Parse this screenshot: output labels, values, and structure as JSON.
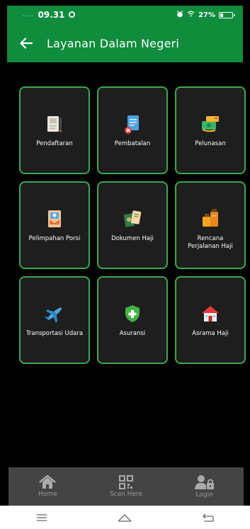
{
  "status": {
    "time": "09.31",
    "signal": "....",
    "battery": "27%",
    "battery_level": 0.27
  },
  "header": {
    "title": "Layanan Dalam Negeri"
  },
  "menu": [
    {
      "label": "Pendaftaran",
      "icon": "registration-icon"
    },
    {
      "label": "Pembatalan",
      "icon": "cancellation-icon"
    },
    {
      "label": "Pelunasan",
      "icon": "payment-icon"
    },
    {
      "label": "Pelimpahan Porsi",
      "icon": "transfer-quota-icon"
    },
    {
      "label": "Dokumen Haji",
      "icon": "hajj-document-icon"
    },
    {
      "label": "Rencana\nPerjalanan Haji",
      "icon": "travel-plan-icon"
    },
    {
      "label": "Transportasi Udara",
      "icon": "airplane-icon"
    },
    {
      "label": "Asuransi",
      "icon": "insurance-shield-icon"
    },
    {
      "label": "Asrama Haji",
      "icon": "dormitory-icon"
    }
  ],
  "bottom_nav": [
    {
      "label": "Home",
      "icon": "home-icon"
    },
    {
      "label": "Scan Here",
      "icon": "qr-scan-icon"
    },
    {
      "label": "Login",
      "icon": "user-lock-icon"
    }
  ],
  "colors": {
    "primary": "#0f8c3c",
    "tile_border": "#3aa84e",
    "tile_bg": "#1e1e1e",
    "nav_bg": "#444444"
  }
}
